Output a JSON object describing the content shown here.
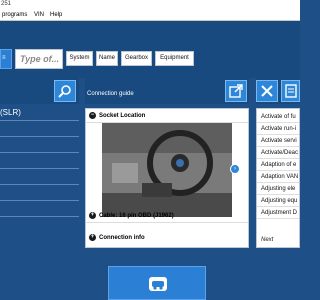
{
  "window": {
    "title": "251"
  },
  "menu": {
    "items": [
      "programs",
      "VIN",
      "Help"
    ]
  },
  "search": {
    "placeholder": "Type of..."
  },
  "filters": [
    "System",
    "Name",
    "Gearbox",
    "Equipment"
  ],
  "left_panel": {
    "title": "(SLR)"
  },
  "connection_guide": {
    "title": "Connection guide",
    "socket_location": "Socket Location",
    "cable": "Cable: 16 pin OBD (J1962)",
    "connection_info": "Connection info"
  },
  "functions": {
    "items": [
      "Activate of fu",
      "Activate run-i",
      "Activate servi",
      "Activate/Deac",
      "Adaption of e",
      "Adaption VAN",
      "Adjusting ele",
      "Adjusting equ",
      "Adjustment D"
    ],
    "next_label": "Next"
  },
  "colors": {
    "background": "#1e4f86",
    "accent": "#2e86d8",
    "panel": "#ffffff"
  }
}
